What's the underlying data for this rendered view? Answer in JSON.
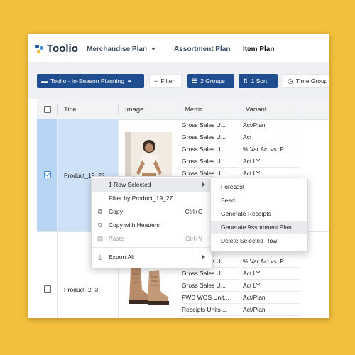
{
  "colors": {
    "background": "#f3bf3c",
    "primary_button": "#1f4d8f",
    "selection": "#cfe1f7",
    "logo_dots": [
      "#1f4d8f",
      "#4a90d9",
      "#f3bf3c"
    ]
  },
  "app": {
    "name": "Toolio"
  },
  "nav": {
    "merch_plan": "Merchandise Plan",
    "assortment_plan": "Assortment Plan",
    "item_plan": "Item Plan"
  },
  "toolbar": {
    "plan_label": "Toolio - In-Season Planning",
    "filter_label": "Filter",
    "groups_label": "2 Groups",
    "sort_label": "1 Sort",
    "time_group_label": "Time Group"
  },
  "grid": {
    "headers": {
      "title": "Title",
      "image": "Image",
      "metric": "Metric",
      "variant": "Variant"
    },
    "product_a": {
      "title": "Product_19_27",
      "selected": true,
      "rows": [
        {
          "metric": "Gross Sales U...",
          "variant": "Act/Plan"
        },
        {
          "metric": "Gross Sales U...",
          "variant": "Act"
        },
        {
          "metric": "Gross Sales U...",
          "variant": "% Var Act vs. P..."
        },
        {
          "metric": "Gross Sales U...",
          "variant": "Act LY"
        },
        {
          "metric": "Gross Sales U...",
          "variant": "Act LY"
        }
      ]
    },
    "product_b": {
      "title": "Product_2_3",
      "selected": false,
      "rows": [
        {
          "metric": "Gross Sales U...",
          "variant": "% Var Act vs. P..."
        },
        {
          "metric": "Gross Sales U...",
          "variant": "Act LY"
        },
        {
          "metric": "Gross Sales U...",
          "variant": "Act LY"
        },
        {
          "metric": "FWD WOS Unit...",
          "variant": "Act/Plan"
        },
        {
          "metric": "Receipts Units ...",
          "variant": "Act/Plan"
        }
      ]
    }
  },
  "context_menu": {
    "row_selected": "1 Row Selected",
    "filter_by": "Filter by Product_19_27",
    "copy": "Copy",
    "copy_shortcut": "Ctrl+C",
    "copy_with_headers": "Copy with Headers",
    "paste": "Paste",
    "paste_shortcut": "Ctrl+V",
    "export_all": "Export All"
  },
  "submenu": {
    "forecast": "Forecast",
    "seed": "Seed",
    "generate_receipts": "Generate Receipts",
    "generate_assortment_plan": "Generate Assortment Plan",
    "delete_selected_row": "Delete Selected Row"
  }
}
